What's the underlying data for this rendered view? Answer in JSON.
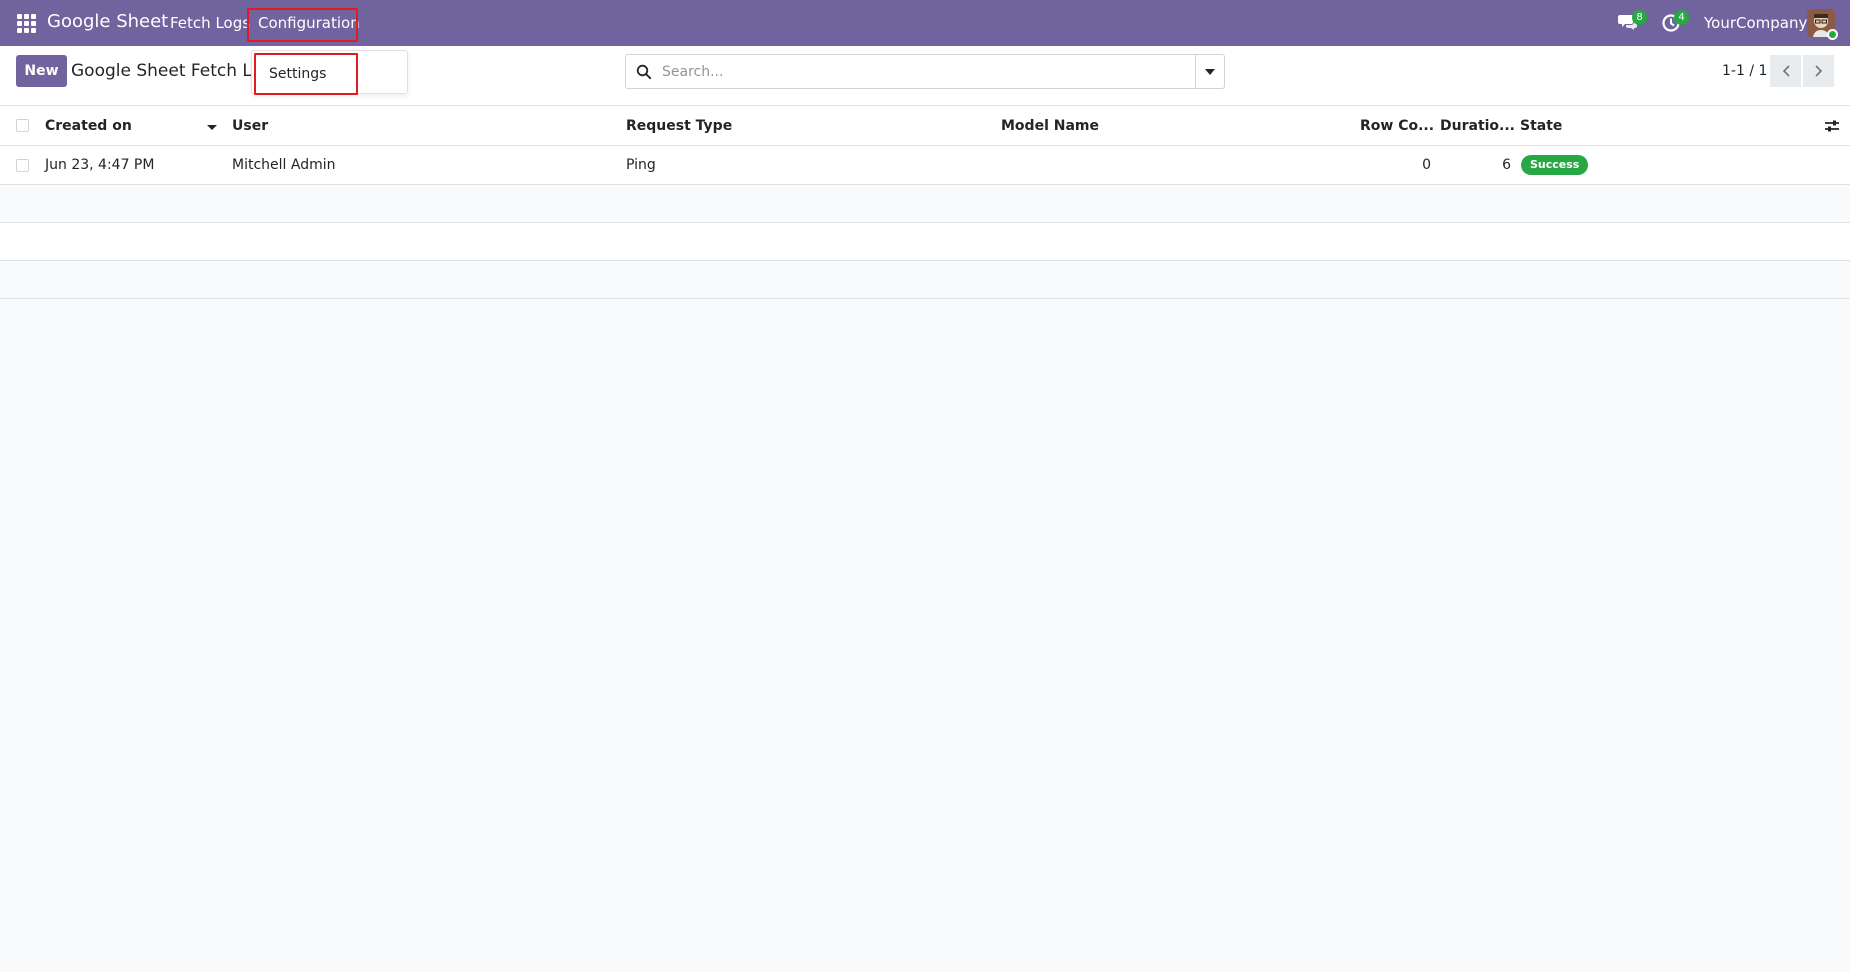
{
  "navbar": {
    "brand": "Google Sheet",
    "menu": [
      {
        "label": "Fetch Logs"
      },
      {
        "label": "Configuration"
      }
    ],
    "chat_count": "8",
    "activity_count": "4",
    "company": "YourCompany",
    "colors": {
      "navbar_bg": "#71639e",
      "badge": "#28a745",
      "highlight": "#e01b24"
    }
  },
  "dropdown": {
    "items": [
      {
        "label": "Settings"
      }
    ]
  },
  "control_panel": {
    "new_label": "New",
    "title": "Google Sheet Fetch Logs",
    "search_placeholder": "Search...",
    "search_value": "",
    "pager_value": "1-1 / 1"
  },
  "list": {
    "columns": [
      "Created on",
      "User",
      "Request Type",
      "Model Name",
      "Row Co...",
      "Duratio...",
      "State"
    ],
    "rows": [
      {
        "created_on": "Jun 23, 4:47 PM",
        "user": "Mitchell Admin",
        "request_type": "Ping",
        "model_name": "",
        "row_count": "0",
        "duration": "6",
        "state": "Success"
      }
    ]
  }
}
